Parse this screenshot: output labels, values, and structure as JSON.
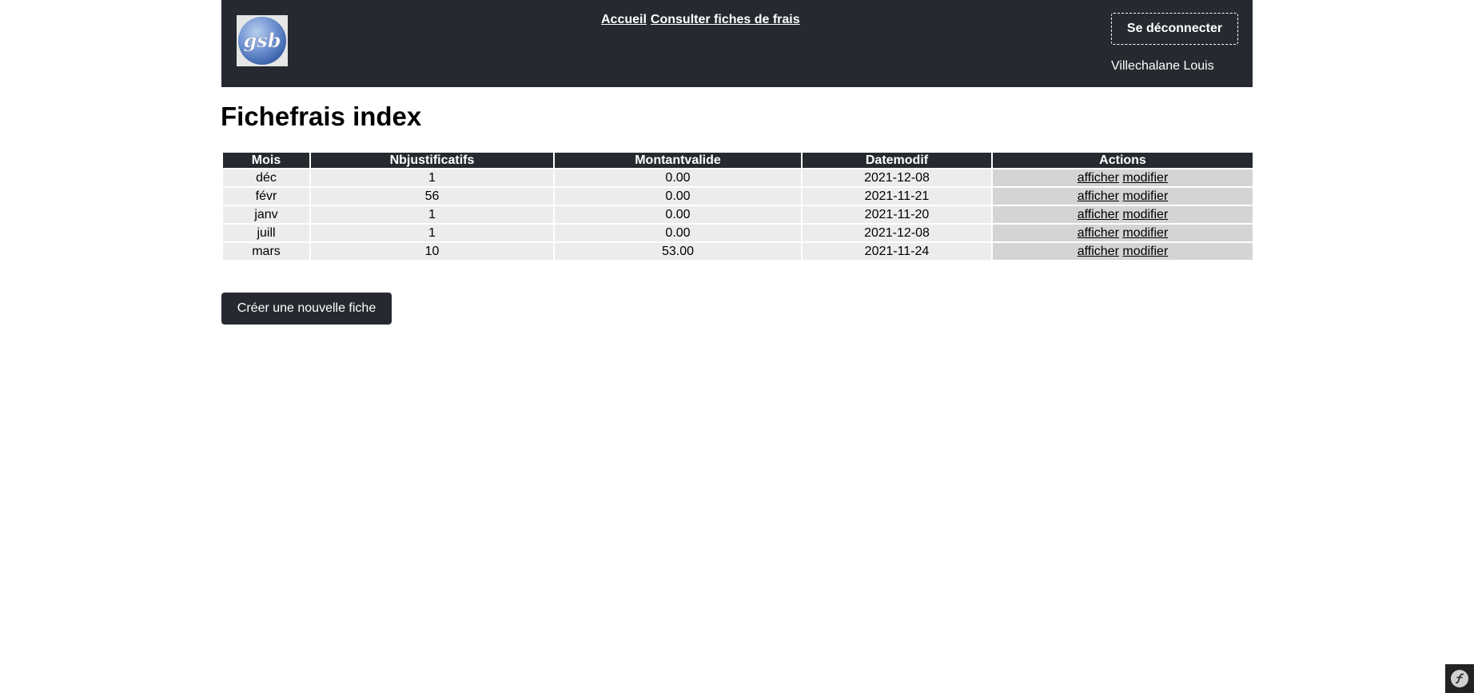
{
  "header": {
    "logo_text": "gsb",
    "nav": [
      {
        "label": "Accueil"
      },
      {
        "label": "Consulter fiches de frais"
      }
    ],
    "logout_label": "Se déconnecter",
    "user_name": "Villechalane Louis",
    "background_color": "#262a30"
  },
  "main": {
    "title": "Fichefrais index",
    "table": {
      "columns": [
        "Mois",
        "Nbjustificatifs",
        "Montantvalide",
        "Datemodif",
        "Actions"
      ],
      "rows": [
        {
          "mois": "déc",
          "nbjustificatifs": "1",
          "montantvalide": "0.00",
          "datemodif": "2021-12-08",
          "show": "afficher",
          "edit": "modifier"
        },
        {
          "mois": "févr",
          "nbjustificatifs": "56",
          "montantvalide": "0.00",
          "datemodif": "2021-11-21",
          "show": "afficher",
          "edit": "modifier"
        },
        {
          "mois": "janv",
          "nbjustificatifs": "1",
          "montantvalide": "0.00",
          "datemodif": "2021-11-20",
          "show": "afficher",
          "edit": "modifier"
        },
        {
          "mois": "juill",
          "nbjustificatifs": "1",
          "montantvalide": "0.00",
          "datemodif": "2021-12-08",
          "show": "afficher",
          "edit": "modifier"
        },
        {
          "mois": "mars",
          "nbjustificatifs": "10",
          "montantvalide": "53.00",
          "datemodif": "2021-11-24",
          "show": "afficher",
          "edit": "modifier"
        }
      ]
    },
    "create_label": "Créer une nouvelle fiche"
  },
  "debug_toolbar": {
    "icon": "symfony-icon"
  }
}
